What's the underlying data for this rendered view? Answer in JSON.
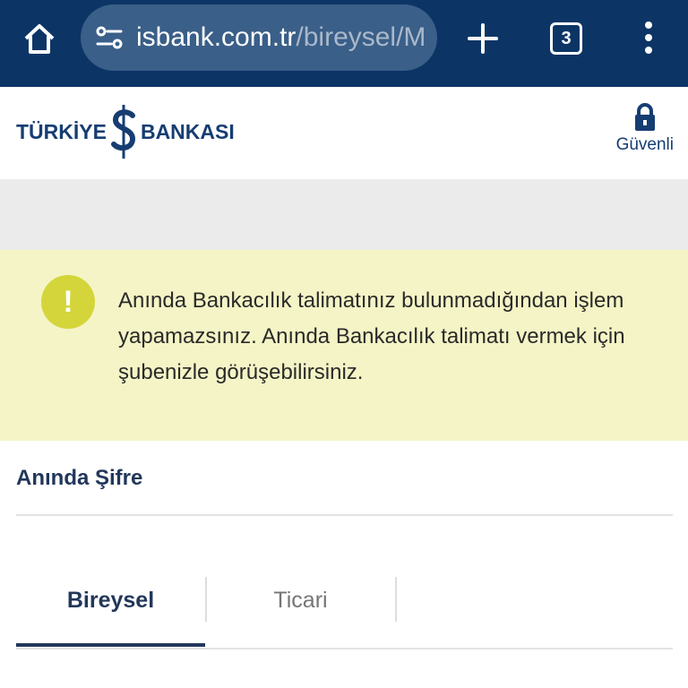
{
  "browser": {
    "url_host": "isbank.com.tr",
    "url_path": "/bireysel/M",
    "tab_count": "3",
    "icons": [
      "home-icon",
      "site-settings-icon",
      "plus-icon",
      "tabs-icon",
      "more-vert-icon"
    ]
  },
  "header": {
    "logo_left": "TÜRKİYE",
    "logo_right": "BANKASI",
    "secure_label": "Güvenli",
    "secure_icon": "lock-icon"
  },
  "alert": {
    "icon": "exclamation-icon",
    "message": "Anında Bankacılık talimatınız bulunmadığından işlem yapamazsınız. Anında Bankacılık talimatı vermek için şubenizle görüşebilirsiniz."
  },
  "section": {
    "title": "Anında Şifre"
  },
  "tabs": [
    {
      "label": "Bireysel",
      "active": true
    },
    {
      "label": "Ticari",
      "active": false
    }
  ],
  "colors": {
    "browser_bar": "#0c3566",
    "url_box": "#3a5f88",
    "brand_navy": "#163d72",
    "alert_bg": "#f5f4c6",
    "alert_icon": "#d4d53a",
    "strip_gray": "#ebebeb"
  }
}
